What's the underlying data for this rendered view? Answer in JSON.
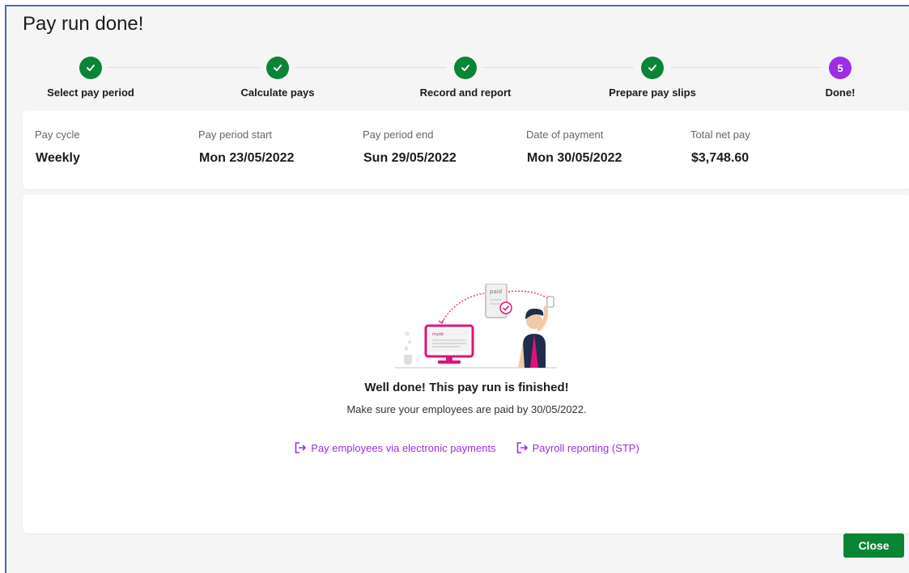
{
  "title": "Pay run done!",
  "steps": [
    {
      "label": "Select pay period",
      "status": "done"
    },
    {
      "label": "Calculate pays",
      "status": "done"
    },
    {
      "label": "Record and report",
      "status": "done"
    },
    {
      "label": "Prepare pay slips",
      "status": "done"
    },
    {
      "label": "Done!",
      "status": "current",
      "number": "5"
    }
  ],
  "summary": {
    "pay_cycle": {
      "label": "Pay cycle",
      "value": "Weekly"
    },
    "period_start": {
      "label": "Pay period start",
      "value": "Mon 23/05/2022"
    },
    "period_end": {
      "label": "Pay period end",
      "value": "Sun 29/05/2022"
    },
    "payment_date": {
      "label": "Date of payment",
      "value": "Mon 30/05/2022"
    },
    "total_net": {
      "label": "Total net pay",
      "value": "$3,748.60"
    }
  },
  "illustration": {
    "device_text": "paid",
    "monitor_text": "myob"
  },
  "message": {
    "headline": "Well done! This pay run is finished!",
    "subline": "Make sure your employees are paid by 30/05/2022."
  },
  "links": {
    "electronic_payments": "Pay employees via electronic payments",
    "payroll_reporting": "Payroll reporting (STP)"
  },
  "close_label": "Close",
  "colors": {
    "success": "#0a8535",
    "accent": "#9b2ee6",
    "brand_pink": "#e0127a",
    "window_border": "#4a6fae"
  },
  "icons": {
    "step_done": "checkmark-icon",
    "link": "external-link-icon"
  }
}
